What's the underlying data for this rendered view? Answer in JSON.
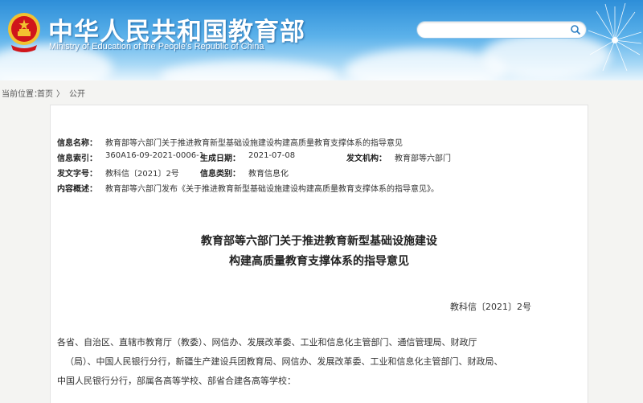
{
  "header": {
    "title": "中华人民共和国教育部",
    "subtitle": "Ministry of Education of the People's Republic of China",
    "search_placeholder": ""
  },
  "breadcrumb": {
    "prefix": "当前位置：",
    "home": "首页",
    "separator": "〉",
    "current": "公开"
  },
  "meta": {
    "name_label": "信息名称：",
    "name_value": "教育部等六部门关于推进教育新型基础设施建设构建高质量教育支撑体系的指导意见",
    "index_label": "信息索引：",
    "index_value": "360A16-09-2021-0006-1",
    "date_label": "生成日期：",
    "date_value": "2021-07-08",
    "org_label": "发文机构：",
    "org_value": "教育部等六部门",
    "docno_label": "发文字号：",
    "docno_value": "教科信〔2021〕2号",
    "category_label": "信息类别：",
    "category_value": "教育信息化",
    "summary_label": "内容概述：",
    "summary_value": "教育部等六部门发布《关于推进教育新型基础设施建设构建高质量教育支撑体系的指导意见》。"
  },
  "document": {
    "title_line1": "教育部等六部门关于推进教育新型基础设施建设",
    "title_line2": "构建高质量教育支撑体系的指导意见",
    "doc_number": "教科信〔2021〕2号",
    "recipients_line1": "各省、自治区、直辖市教育厅（教委）、网信办、发展改革委、工业和信息化主管部门、通信管理局、财政厅",
    "recipients_line2": "（局）、中国人民银行分行，新疆生产建设兵团教育局、网信办、发展改革委、工业和信息化主管部门、财政局、",
    "recipients_line3": "中国人民银行分行，部属各高等学校、部省合建各高等学校："
  },
  "colors": {
    "header_blue": "#2d8ed8",
    "emblem_red": "#d0161b",
    "emblem_gold": "#f2c230"
  }
}
